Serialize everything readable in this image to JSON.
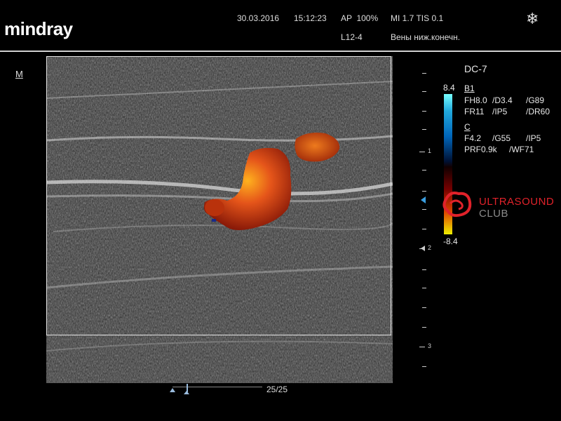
{
  "brand": "mindray",
  "header": {
    "date": "30.03.2016",
    "time": "15:12:23",
    "ap": "AP  100%",
    "mi_tis": "MI 1.7 TIS 0.1",
    "probe": "L12-4",
    "exam": "Вены ниж.конечн.",
    "freeze_icon": "snowflake-icon"
  },
  "mode_marker": "M",
  "params": {
    "mode_title": "DC-7",
    "b_section": "B1",
    "b_line1": [
      "FH8.0",
      "/D3.4",
      "/G89"
    ],
    "b_line2": [
      "FR11",
      "/IP5",
      "/DR60"
    ],
    "c_section": "C",
    "c_line1": [
      "F4.2",
      "/G55",
      "/IP5"
    ],
    "c_line2": [
      "PRF0.9k",
      "/WF71"
    ]
  },
  "color_scale": {
    "max": "8.4",
    "min": "-8.4"
  },
  "depth_labels": [
    "1",
    "2",
    "3"
  ],
  "cine": {
    "frame": "25/25"
  },
  "watermark": {
    "line1": "ULTRASOUND",
    "line2": "CLUB",
    "accent": "#e0222a"
  }
}
